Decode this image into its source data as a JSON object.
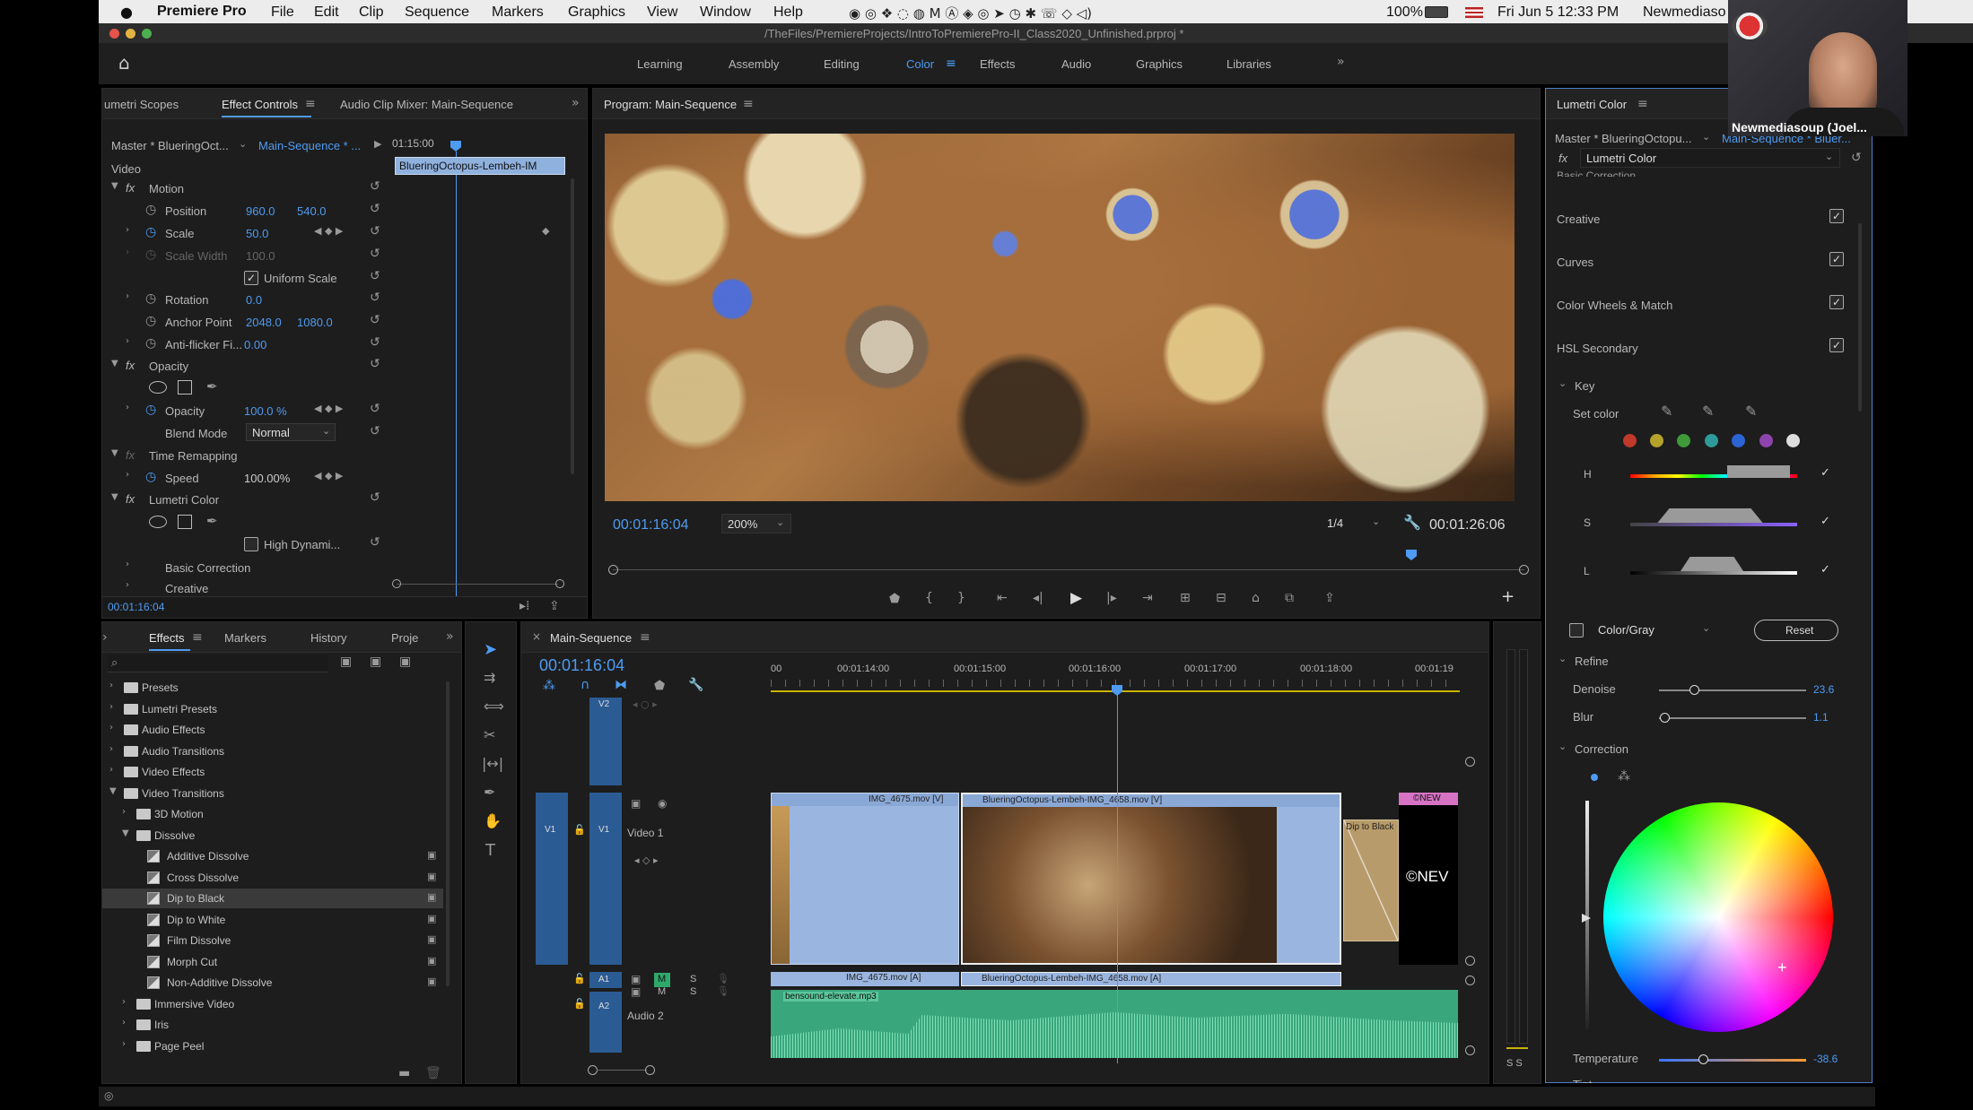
{
  "menubar": {
    "apple": "",
    "app": "Premiere Pro",
    "items": [
      "File",
      "Edit",
      "Clip",
      "Sequence",
      "Markers",
      "Graphics",
      "View",
      "Window",
      "Help"
    ],
    "battery": "100%",
    "datetime": "Fri Jun 5  12:33 PM",
    "user": "Newmediaso"
  },
  "title_path": "/TheFiles/PremiereProjects/IntroToPremierePro-II_Class2020_Unfinished.prproj *",
  "workspaces": [
    "Learning",
    "Assembly",
    "Editing",
    "Color",
    "Effects",
    "Audio",
    "Graphics",
    "Libraries"
  ],
  "active_workspace": "Color",
  "left_panel": {
    "tabs": [
      "umetri Scopes",
      "Effect Controls",
      "Audio Clip Mixer: Main-Sequence"
    ],
    "master": "Master * BlueringOct...",
    "sequence": "Main-Sequence * ...",
    "time_top": "01:15:00",
    "clip_bar": "BlueringOctopus-Lembeh-IM",
    "video_label": "Video",
    "rows": [
      {
        "name": "Motion",
        "fx": true
      },
      {
        "name": "Position",
        "v1": "960.0",
        "v2": "540.0"
      },
      {
        "name": "Scale",
        "v1": "50.0"
      },
      {
        "name": "Scale Width",
        "v1": "100.0"
      },
      {
        "name": "Uniform Scale"
      },
      {
        "name": "Rotation",
        "v1": "0.0"
      },
      {
        "name": "Anchor Point",
        "v1": "2048.0",
        "v2": "1080.0"
      },
      {
        "name": "Anti-flicker Fi...",
        "v1": "0.00"
      },
      {
        "name": "Opacity",
        "fx": true
      },
      {
        "name": "Opacity",
        "v1": "100.0 %"
      },
      {
        "name": "Blend Mode",
        "v1": "Normal"
      },
      {
        "name": "Time Remapping",
        "fx": true
      },
      {
        "name": "Speed",
        "v1": "100.00%"
      },
      {
        "name": "Lumetri Color",
        "fx": true
      },
      {
        "name": "High Dynami..."
      },
      {
        "name": "Basic Correction"
      },
      {
        "name": "Creative"
      }
    ],
    "timecode": "00:01:16:04"
  },
  "program": {
    "title": "Program: Main-Sequence",
    "timecode": "00:01:16:04",
    "zoom": "200%",
    "quality": "1/4",
    "duration": "00:01:26:06"
  },
  "lumetri": {
    "title": "Lumetri Color",
    "master": "Master * BlueringOctopu...",
    "sequence": "Main-Sequence * Bluer...",
    "effect": "Lumetri Color",
    "partial": "Basic Correction",
    "sections": [
      "Creative",
      "Curves",
      "Color Wheels & Match",
      "HSL Secondary"
    ],
    "key": "Key",
    "set_color": "Set color",
    "swatches": [
      "#c0392b",
      "#b5a22a",
      "#3f9a3a",
      "#2f9a9a",
      "#2c64d6",
      "#8e44ad",
      "#dddddd"
    ],
    "hsl": [
      "H",
      "S",
      "L"
    ],
    "colorgray": "Color/Gray",
    "reset": "Reset",
    "refine": "Refine",
    "denoise_label": "Denoise",
    "denoise": "23.6",
    "blur_label": "Blur",
    "blur": "1.1",
    "correction": "Correction",
    "temperature_label": "Temperature",
    "temperature": "-38.6",
    "tint_label": "Tint"
  },
  "webcam": {
    "name": "Newmediasoup (Joel..."
  },
  "effects_panel": {
    "tabs": [
      "Effects",
      "Markers",
      "History",
      "Proje"
    ],
    "items": [
      {
        "label": "Presets",
        "level": 0,
        "open": false
      },
      {
        "label": "Lumetri Presets",
        "level": 0,
        "open": false
      },
      {
        "label": "Audio Effects",
        "level": 0,
        "open": false
      },
      {
        "label": "Audio Transitions",
        "level": 0,
        "open": false
      },
      {
        "label": "Video Effects",
        "level": 0,
        "open": false
      },
      {
        "label": "Video Transitions",
        "level": 0,
        "open": true
      },
      {
        "label": "3D Motion",
        "level": 1,
        "open": false
      },
      {
        "label": "Dissolve",
        "level": 1,
        "open": true
      },
      {
        "label": "Additive Dissolve",
        "level": 2,
        "fx": true
      },
      {
        "label": "Cross Dissolve",
        "level": 2,
        "fx": true
      },
      {
        "label": "Dip to Black",
        "level": 2,
        "fx": true,
        "selected": true
      },
      {
        "label": "Dip to White",
        "level": 2,
        "fx": true
      },
      {
        "label": "Film Dissolve",
        "level": 2,
        "fx": true
      },
      {
        "label": "Morph Cut",
        "level": 2,
        "fx": true
      },
      {
        "label": "Non-Additive Dissolve",
        "level": 2,
        "fx": true
      },
      {
        "label": "Immersive Video",
        "level": 1,
        "open": false
      },
      {
        "label": "Iris",
        "level": 1,
        "open": false
      },
      {
        "label": "Page Peel",
        "level": 1,
        "open": false
      }
    ]
  },
  "timeline": {
    "title": "Main-Sequence",
    "timecode": "00:01:16:04",
    "ruler": [
      "00",
      "00:01:14:00",
      "00:01:15:00",
      "00:01:16:00",
      "00:01:17:00",
      "00:01:18:00",
      "00:01:19"
    ],
    "tracks": {
      "v2": "V2",
      "v1": "V1",
      "v1_src": "V1",
      "video1": "Video 1",
      "a1": "A1",
      "a1_src": "A1",
      "a2": "A2",
      "audio2": "Audio 2",
      "m": "M",
      "s": "S"
    },
    "clips": {
      "v_img": "IMG_4675.mov [V]",
      "v_octo": "BlueringOctopus-Lembeh-IMG_4658.mov [V]",
      "v_new": "©NEW",
      "dip": "Dip to Black",
      "new_text": "©NEV",
      "a_img": "IMG_4675.mov [A]",
      "a_octo": "BlueringOctopus-Lembeh-IMG_4658.mov [A]",
      "music": "bensound-elevate.mp3"
    },
    "meter": "S S"
  }
}
